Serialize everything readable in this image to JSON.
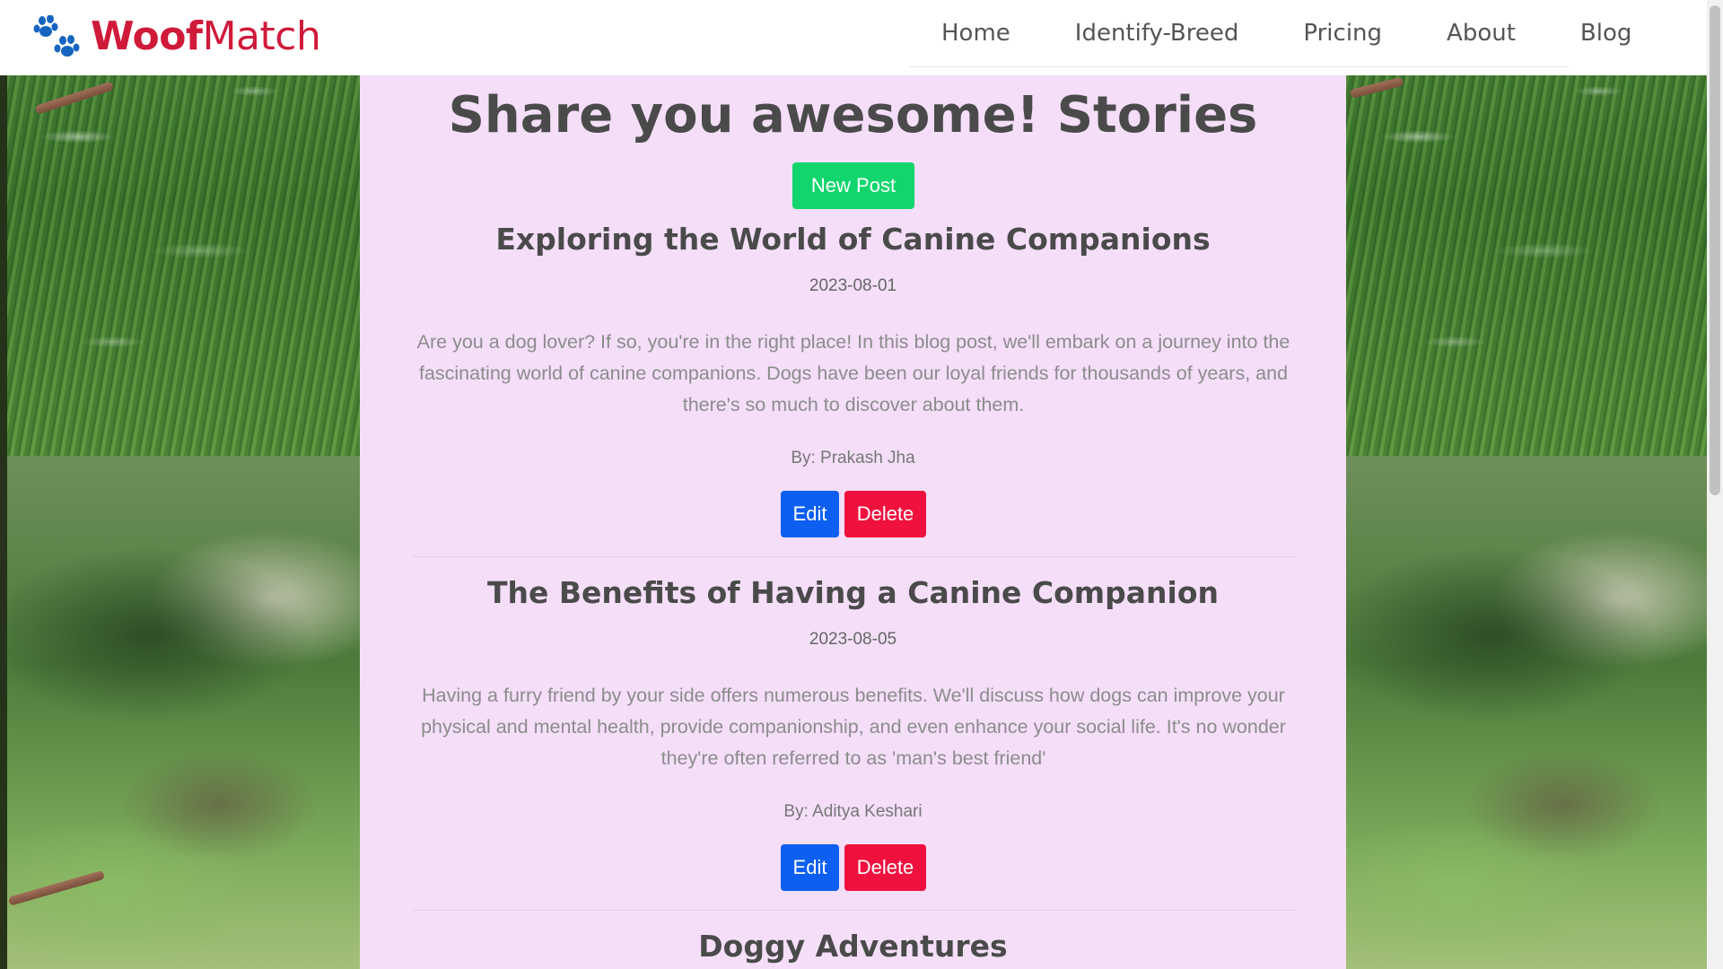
{
  "brand": {
    "bold": "Woof",
    "light": "Match"
  },
  "nav": [
    {
      "label": "Home"
    },
    {
      "label": "Identify-Breed"
    },
    {
      "label": "Pricing"
    },
    {
      "label": "About"
    },
    {
      "label": "Blog"
    }
  ],
  "page": {
    "title": "Share you awesome! Stories",
    "new_post_label": "New Post"
  },
  "posts": [
    {
      "title": "Exploring the World of Canine Companions",
      "date": "2023-08-01",
      "body": "Are you a dog lover? If so, you're in the right place! In this blog post, we'll embark on a journey into the fascinating world of canine companions. Dogs have been our loyal friends for thousands of years, and there's so much to discover about them.",
      "author": "By: Prakash Jha",
      "edit_label": "Edit",
      "delete_label": "Delete"
    },
    {
      "title": "The Benefits of Having a Canine Companion",
      "date": "2023-08-05",
      "body": "Having a furry friend by your side offers numerous benefits. We'll discuss how dogs can improve your physical and mental health, provide companionship, and even enhance your social life. It's no wonder they're often referred to as 'man's best friend'",
      "author": "By: Aditya Keshari",
      "edit_label": "Edit",
      "delete_label": "Delete"
    },
    {
      "title": "Doggy Adventures"
    }
  ],
  "colors": {
    "brand": "#d01a3a",
    "paw": "#1565c0",
    "panel_bg": "#f4def8",
    "new_post_button": "#12d66d",
    "edit_button": "#0d5ff2",
    "delete_button": "#f0113f"
  },
  "icons": {
    "logo": "paw-print-icon"
  }
}
